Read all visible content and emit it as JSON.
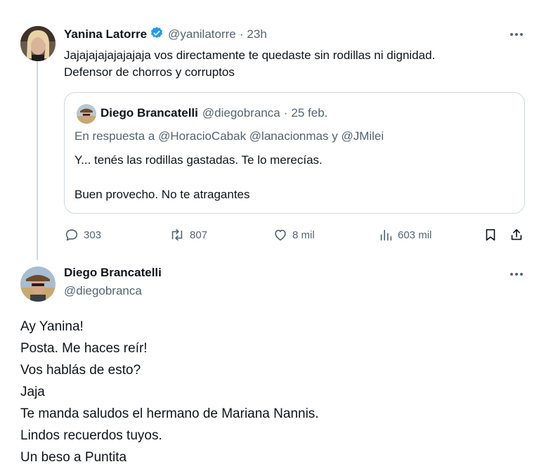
{
  "tweet": {
    "author_name": "Yanina Latorre",
    "handle": "@yanilatorre",
    "separator": "·",
    "time": "23h",
    "text_line1": "Jajajajajajajajaja vos directamente te quedaste sin rodillas ni dignidad.",
    "text_line2": "Defensor de chorros y corruptos",
    "quote": {
      "author_name": "Diego Brancatelli",
      "handle": "@diegobranca",
      "separator": "·",
      "date": "25 feb.",
      "reply_prefix": "En respuesta a",
      "reply_to": "@HoracioCabak @lanacionmas y @JMilei",
      "line1": "Y... tenés las rodillas gastadas. Te lo merecías.",
      "line2": "Buen provecho. No te atragantes"
    },
    "actions": {
      "replies": "303",
      "retweets": "807",
      "likes": "8 mil",
      "views": "603 mil"
    }
  },
  "reply": {
    "author_name": "Diego Brancatelli",
    "handle": "@diegobranca",
    "lines": [
      "Ay Yanina!",
      "Posta. Me haces reír!",
      "Vos hablás de esto?",
      "Jaja",
      "Te manda saludos el hermano de Mariana Nannis.",
      "Lindos recuerdos tuyos.",
      "Un beso a Puntita"
    ]
  },
  "colors": {
    "verified": "#1d9bf0",
    "muted": "#536471",
    "border": "#cfd9de",
    "reply_to_link": "#536471"
  },
  "icons": [
    "verified-badge-icon",
    "more-icon",
    "reply-icon",
    "retweet-icon",
    "like-icon",
    "views-icon",
    "bookmark-icon",
    "share-icon"
  ]
}
